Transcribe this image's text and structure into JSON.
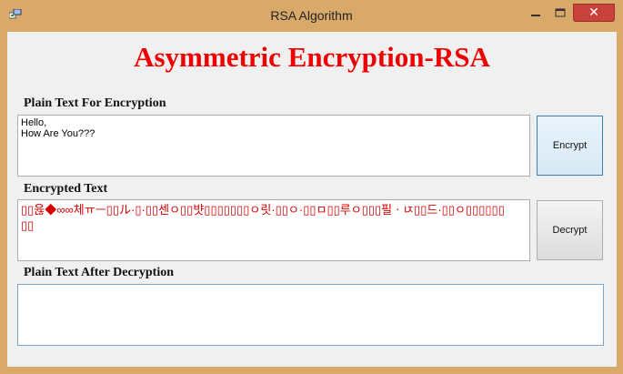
{
  "window": {
    "title": "RSA Algorithm",
    "close_glyph": "✕"
  },
  "heading": "Asymmetric Encryption-RSA",
  "plain": {
    "label": "Plain Text For Encryption",
    "value": "Hello,\nHow Are You???"
  },
  "encrypt_button": "Encrypt",
  "encrypted": {
    "label": "Encrypted Text",
    "value": "▯▯윦◆∞∞체ㅠㅡ▯▯ル·▯·▯▯센ㅇ▯▯뱟▯▯▯▯▯▯▯ㅇ릿·▯▯ㅇ·▯▯ㅁ▯▯루ㅇ▯▯▯필ㆍㄵ▯▯드·▯▯ㅇ▯▯▯▯▯▯\n▯▯"
  },
  "decrypt_button": "Decrypt",
  "decrypted": {
    "label": "Plain Text After Decryption",
    "value": ""
  },
  "colors": {
    "title_bar": "#d9a96a",
    "heading": "#ee0000",
    "encrypted_text": "#d40000",
    "close_button": "#c8413a"
  }
}
